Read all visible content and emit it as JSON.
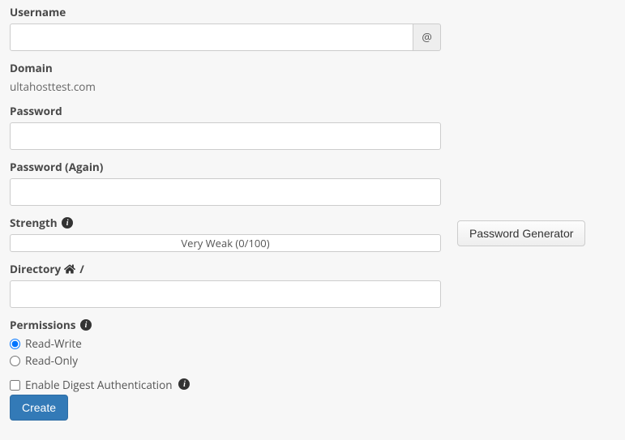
{
  "username": {
    "label": "Username",
    "value": "",
    "addon": "@"
  },
  "domain": {
    "label": "Domain",
    "value": "ultahosttest.com"
  },
  "password": {
    "label": "Password",
    "value": ""
  },
  "password_again": {
    "label": "Password (Again)",
    "value": ""
  },
  "strength": {
    "label": "Strength",
    "text": "Very Weak (0/100)"
  },
  "password_generator_label": "Password Generator",
  "directory": {
    "label": "Directory",
    "separator": "/",
    "value": ""
  },
  "permissions": {
    "label": "Permissions",
    "options": {
      "read_write": "Read-Write",
      "read_only": "Read-Only"
    },
    "selected": "read_write"
  },
  "digest": {
    "label": "Enable Digest Authentication",
    "checked": false
  },
  "create_label": "Create"
}
